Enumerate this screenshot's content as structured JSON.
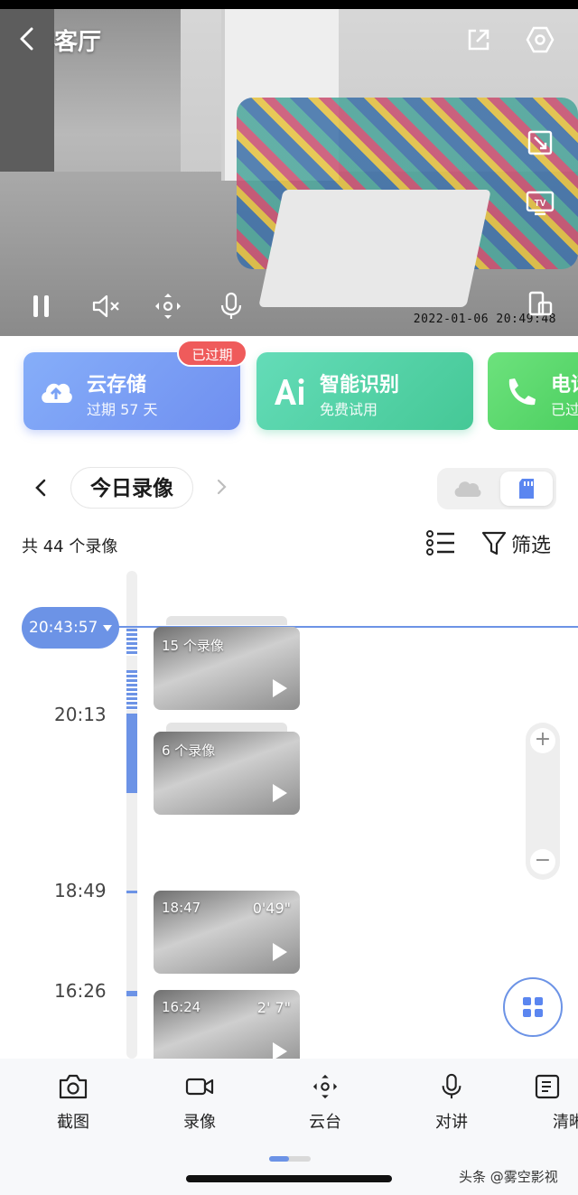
{
  "header": {
    "title": "客厅",
    "back_icon": "chevron-left-icon",
    "share_icon": "share-out-icon",
    "settings_icon": "hexagon-settings-icon"
  },
  "video": {
    "timestamp": "2022-01-06 20:49:48",
    "side_controls": [
      "screen-resize-icon",
      "tv-cast-icon",
      "rotate-device-icon"
    ],
    "bottom_controls": [
      "pause-icon",
      "mute-icon",
      "ptz-icon",
      "microphone-icon"
    ]
  },
  "services": [
    {
      "title": "云存储",
      "subtitle": "过期 57 天",
      "badge": "已过期",
      "icon": "cloud-upload-icon",
      "color": "#7aa2f5"
    },
    {
      "title": "智能识别",
      "subtitle": "免费试用",
      "icon": "ai-icon",
      "color": "#54d2aa"
    },
    {
      "title": "电话",
      "subtitle": "已过",
      "icon": "phone-icon",
      "color": "#57d66b"
    }
  ],
  "date": {
    "label": "今日录像"
  },
  "summary": {
    "count": "共 44 个录像",
    "filter": "筛选"
  },
  "timeline": {
    "current_time": "20:43:57",
    "time_labels": [
      "20:13",
      "18:49",
      "16:26"
    ],
    "clips": [
      {
        "label": "15 个录像",
        "duration": ""
      },
      {
        "label": "6 个录像",
        "duration": ""
      },
      {
        "label": "18:47",
        "duration": "0'49\""
      },
      {
        "label": "16:24",
        "duration": "2' 7\""
      }
    ],
    "zoom_in": "+",
    "zoom_out": "−"
  },
  "bottom_bar": [
    {
      "label": "截图",
      "icon": "camera-icon"
    },
    {
      "label": "录像",
      "icon": "video-camera-icon"
    },
    {
      "label": "云台",
      "icon": "ptz-icon"
    },
    {
      "label": "对讲",
      "icon": "microphone-icon"
    },
    {
      "label": "清晰",
      "icon": "hd-quality-icon"
    }
  ],
  "watermark": "头条 @雾空影视",
  "colors": {
    "accent": "#6c93e6",
    "badge": "#ef5b5b"
  }
}
